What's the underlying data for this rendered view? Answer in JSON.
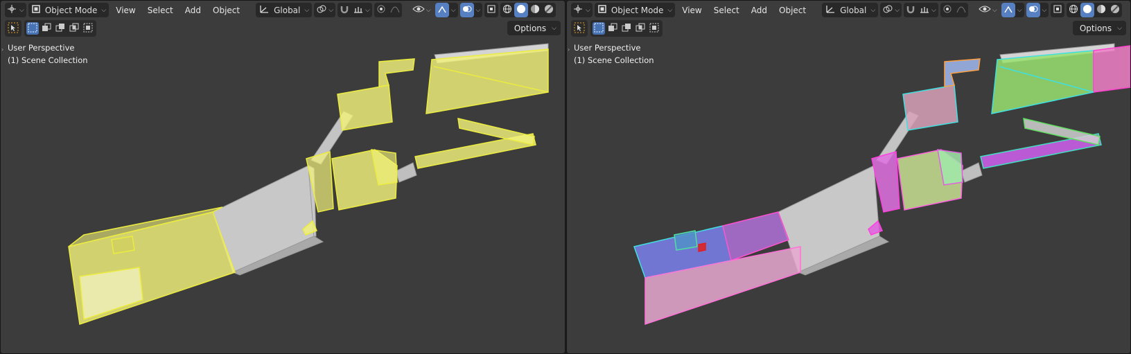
{
  "viewports": [
    {
      "id": "left",
      "header": {
        "mode_label": "Object Mode",
        "menus": [
          "View",
          "Select",
          "Add",
          "Object"
        ],
        "orientation_label": "Global"
      },
      "options_label": "Options",
      "overlay": {
        "perspective": "User Perspective",
        "collection": "(1) Scene Collection"
      },
      "scene_style": "yellow-selection"
    },
    {
      "id": "right",
      "header": {
        "mode_label": "Object Mode",
        "menus": [
          "View",
          "Select",
          "Add",
          "Object"
        ],
        "orientation_label": "Global"
      },
      "options_label": "Options",
      "overlay": {
        "perspective": "User Perspective",
        "collection": "(1) Scene Collection"
      },
      "scene_style": "random-colors"
    }
  ],
  "icons": {
    "editor_type": "view3d-editor-icon",
    "mode": "object-mode-icon",
    "orientation": "transform-orientation-icon",
    "pivot": "pivot-point-icon",
    "snap": "snap-magnet-icon",
    "snap_target": "snap-increment-icon",
    "proportional": "proportional-edit-icon",
    "falloff": "falloff-curve-icon",
    "visibility": "eye-icon",
    "gizmo": "gizmo-icon",
    "overlays": "overlays-icon",
    "xray": "xray-icon",
    "shading": [
      "wireframe-icon",
      "solid-icon",
      "material-icon",
      "rendered-icon"
    ]
  },
  "colors": {
    "viewport_bg": "#3c3c3c",
    "header_btn": "#282828",
    "accent_blue": "#4772b3",
    "selection_yellow": "#f2f27a",
    "solid_gray": "#c8c8c8"
  }
}
